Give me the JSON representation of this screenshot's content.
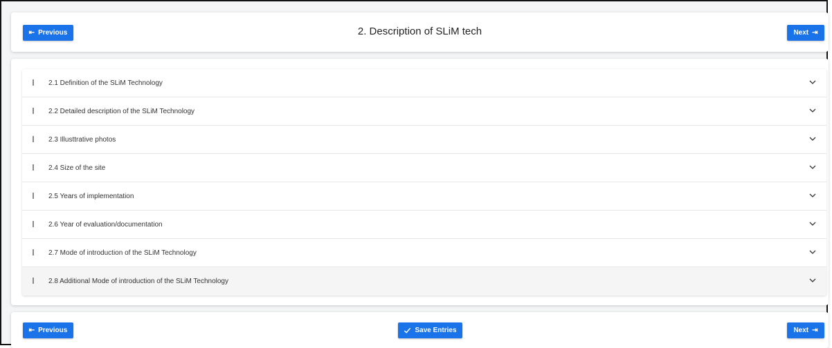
{
  "header": {
    "title": "2. Description of SLiM tech",
    "prev_label": "Previous",
    "next_label": "Next",
    "prev_icon": "arrow-left-bar-icon",
    "next_icon": "arrow-right-bar-icon"
  },
  "sections": [
    {
      "label": "2.1 Definition of the SLiM Technology"
    },
    {
      "label": "2.2 Detailed description of the SLiM Technology"
    },
    {
      "label": "2.3 Illusttrative photos"
    },
    {
      "label": "2.4 Size of the site"
    },
    {
      "label": "2.5 Years of implementation"
    },
    {
      "label": "2.6 Year of evaluation/documentation"
    },
    {
      "label": "2.7 Mode of introduction of the SLiM Technology"
    },
    {
      "label": "2.8 Additional Mode of introduction of the SLiM Technology"
    }
  ],
  "footer": {
    "prev_label": "Previous",
    "save_label": "Save Entries",
    "next_label": "Next",
    "save_icon": "checkmark-icon"
  },
  "colors": {
    "accent": "#1a73e8",
    "active_row": "#f5f5f5"
  }
}
